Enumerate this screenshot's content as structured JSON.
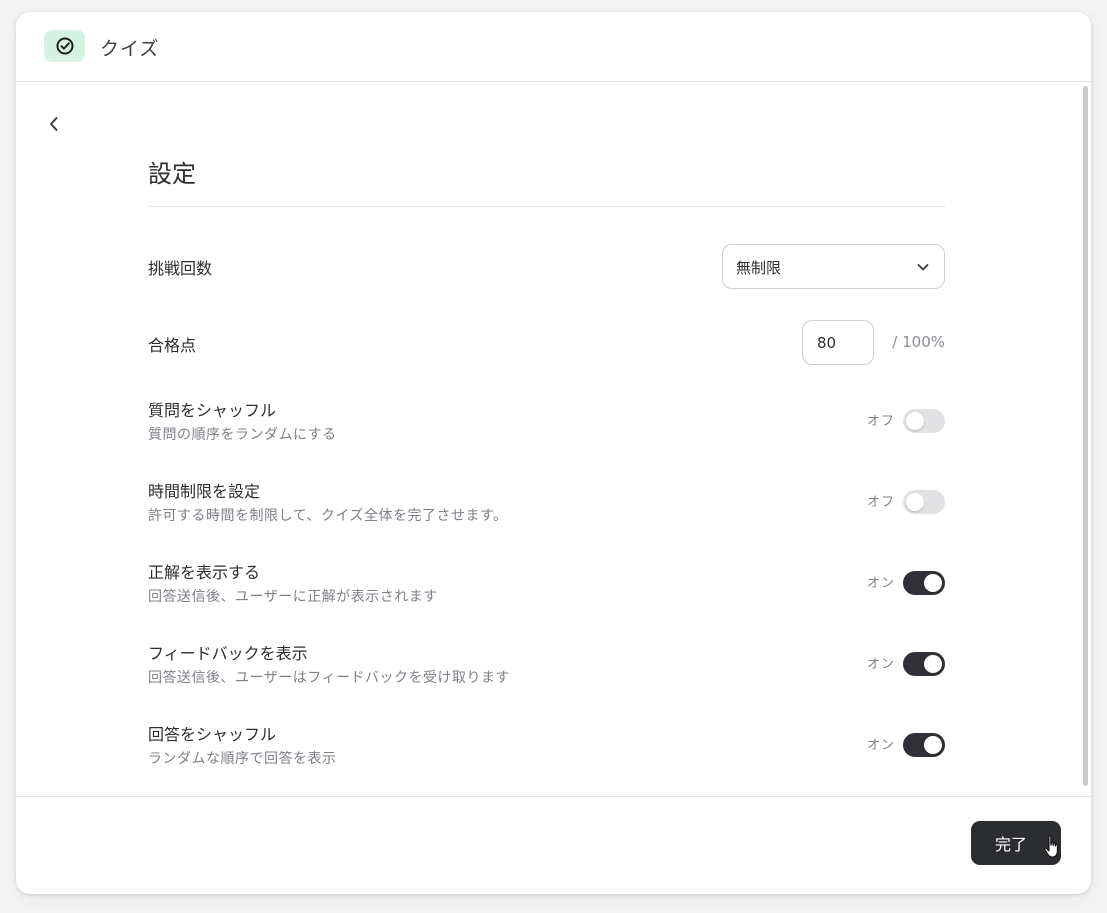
{
  "app": {
    "title": "クイズ",
    "icon": "check-circle-icon",
    "accent_color": "#d7f2e3"
  },
  "navigation": {
    "back_icon": "chevron-left-icon"
  },
  "page": {
    "title": "設定"
  },
  "attempts": {
    "label": "挑戦回数",
    "selected": "無制限",
    "icon": "chevron-down-icon"
  },
  "passing_score": {
    "label": "合格点",
    "value": "80",
    "suffix": "/ 100%"
  },
  "toggles": [
    {
      "title": "質問をシャッフル",
      "description": "質問の順序をランダムにする",
      "state_label": "オフ",
      "on": false
    },
    {
      "title": "時間制限を設定",
      "description": "許可する時間を制限して、クイズ全体を完了させます。",
      "state_label": "オフ",
      "on": false
    },
    {
      "title": "正解を表示する",
      "description": "回答送信後、ユーザーに正解が表示されます",
      "state_label": "オン",
      "on": true
    },
    {
      "title": "フィードバックを表示",
      "description": "回答送信後、ユーザーはフィードバックを受け取ります",
      "state_label": "オン",
      "on": true
    },
    {
      "title": "回答をシャッフル",
      "description": "ランダムな順序で回答を表示",
      "state_label": "オン",
      "on": true
    }
  ],
  "footer": {
    "done_label": "完了",
    "button_color": "#2b2d31"
  }
}
